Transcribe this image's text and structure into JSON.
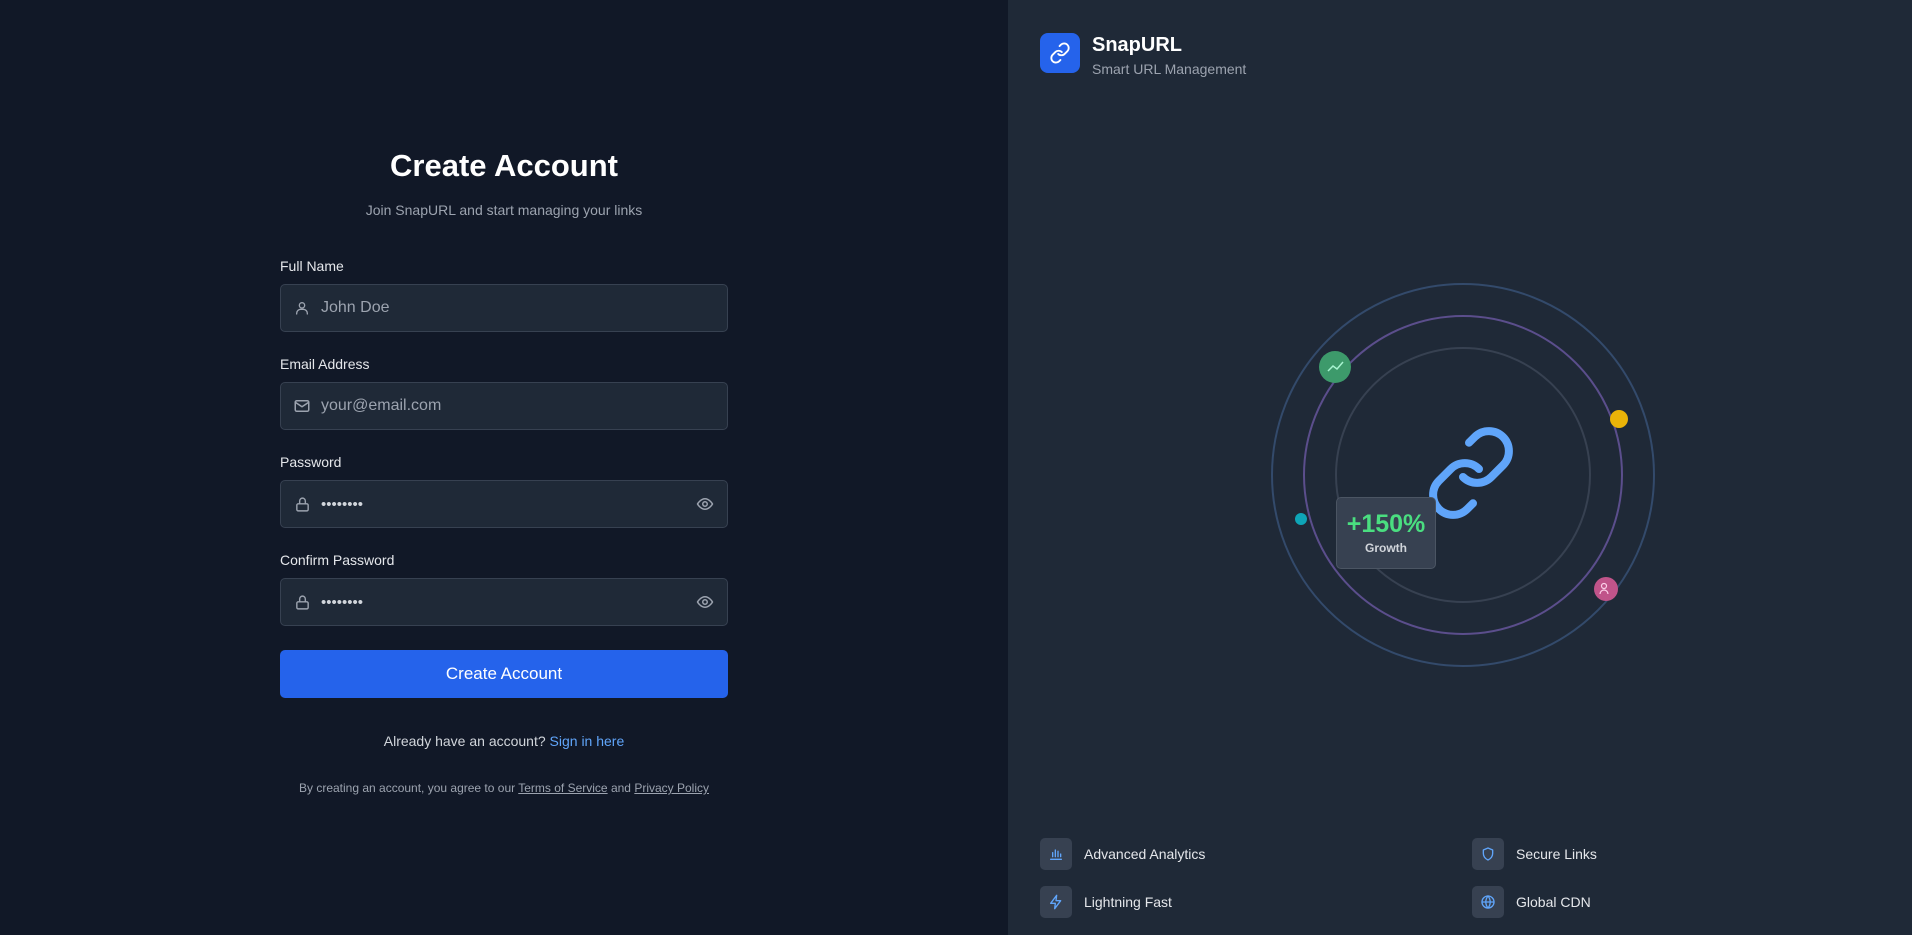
{
  "form": {
    "title": "Create Account",
    "subtitle": "Join SnapURL and start managing your links",
    "full_name": {
      "label": "Full Name",
      "placeholder": "John Doe"
    },
    "email": {
      "label": "Email Address",
      "placeholder": "your@email.com"
    },
    "password": {
      "label": "Password",
      "value": "••••••••"
    },
    "confirm_password": {
      "label": "Confirm Password",
      "value": "••••••••"
    },
    "submit_label": "Create Account",
    "signin_prompt": "Already have an account?",
    "signin_link": "Sign in here",
    "terms_prefix": "By creating an account, you agree to our",
    "terms_link": "Terms of Service",
    "terms_and": "and",
    "privacy_link": "Privacy Policy"
  },
  "brand": {
    "name": "SnapURL",
    "tagline": "Smart URL Management"
  },
  "visual": {
    "growth_value": "+150%",
    "growth_label": "Growth"
  },
  "features": [
    {
      "label": "Advanced Analytics",
      "icon": "bar-chart-icon"
    },
    {
      "label": "Secure Links",
      "icon": "shield-icon"
    },
    {
      "label": "Lightning Fast",
      "icon": "lightning-icon"
    },
    {
      "label": "Global CDN",
      "icon": "globe-icon"
    }
  ],
  "colors": {
    "accent": "#2563eb",
    "link": "#60a5fa",
    "growth": "#4ade80",
    "bg_left": "#111827",
    "bg_right": "#1f2937"
  }
}
